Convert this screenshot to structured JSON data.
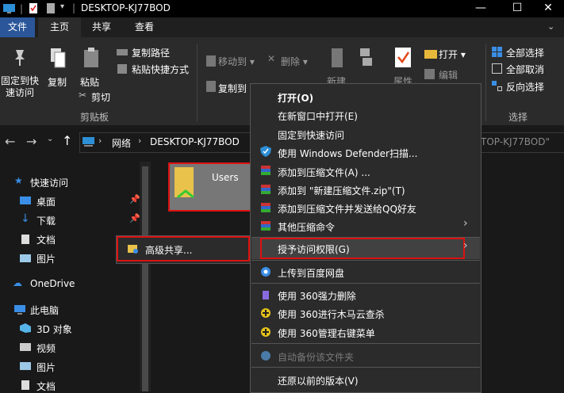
{
  "window": {
    "title": "DESKTOP-KJ77BOD"
  },
  "tabs": [
    "文件",
    "主页",
    "共享",
    "查看"
  ],
  "ribbon": {
    "pin_quick_access": "固定到快\n速访问",
    "pin_l1": "固定到快",
    "pin_l2": "速访问",
    "copy": "复制",
    "paste": "粘贴",
    "copy_path": "复制路径",
    "paste_shortcut": "粘贴快捷方式",
    "cut": "剪切",
    "clipboard_group": "剪贴板",
    "move_to": "移动到",
    "copy_to": "复制到",
    "delete": "删除",
    "new": "新建",
    "properties": "属性",
    "open": "打开",
    "edit": "编辑",
    "select_all": "全部选择",
    "select_none": "全部取消",
    "invert_selection": "反向选择",
    "select_group": "选择"
  },
  "address": {
    "crumbs": [
      "网络",
      "DESKTOP-KJ77BOD"
    ],
    "search_partial": "TOP-KJ77BOD\""
  },
  "nav": {
    "quick_access": "快速访问",
    "desktop": "桌面",
    "downloads": "下载",
    "documents": "文档",
    "pictures": "图片",
    "onedrive": "OneDrive",
    "this_pc": "此电脑",
    "objects3d": "3D 对象",
    "videos": "视频",
    "pictures2": "图片",
    "documents2": "文档"
  },
  "content": {
    "folder_name": "Users"
  },
  "context_menu": {
    "open": "打开(O)",
    "open_new_window": "在新窗口中打开(E)",
    "pin_quick": "固定到快速访问",
    "defender": "使用 Windows Defender扫描...",
    "add_archive": "添加到压缩文件(A) ...",
    "add_zip": "添加到 \"新建压缩文件.zip\"(T)",
    "add_zip_qq": "添加到压缩文件并发送给QQ好友",
    "other_compress": "其他压缩命令",
    "grant_access": "授予访问权限(G)",
    "baidu": "上传到百度网盘",
    "del360": "使用 360强力删除",
    "trojan360": "使用 360进行木马云查杀",
    "manage360": "使用 360管理右键菜单",
    "auto_backup": "自动备份该文件夹",
    "restore": "还原以前的版本(V)"
  },
  "submenu": {
    "advanced_sharing": "高级共享..."
  }
}
